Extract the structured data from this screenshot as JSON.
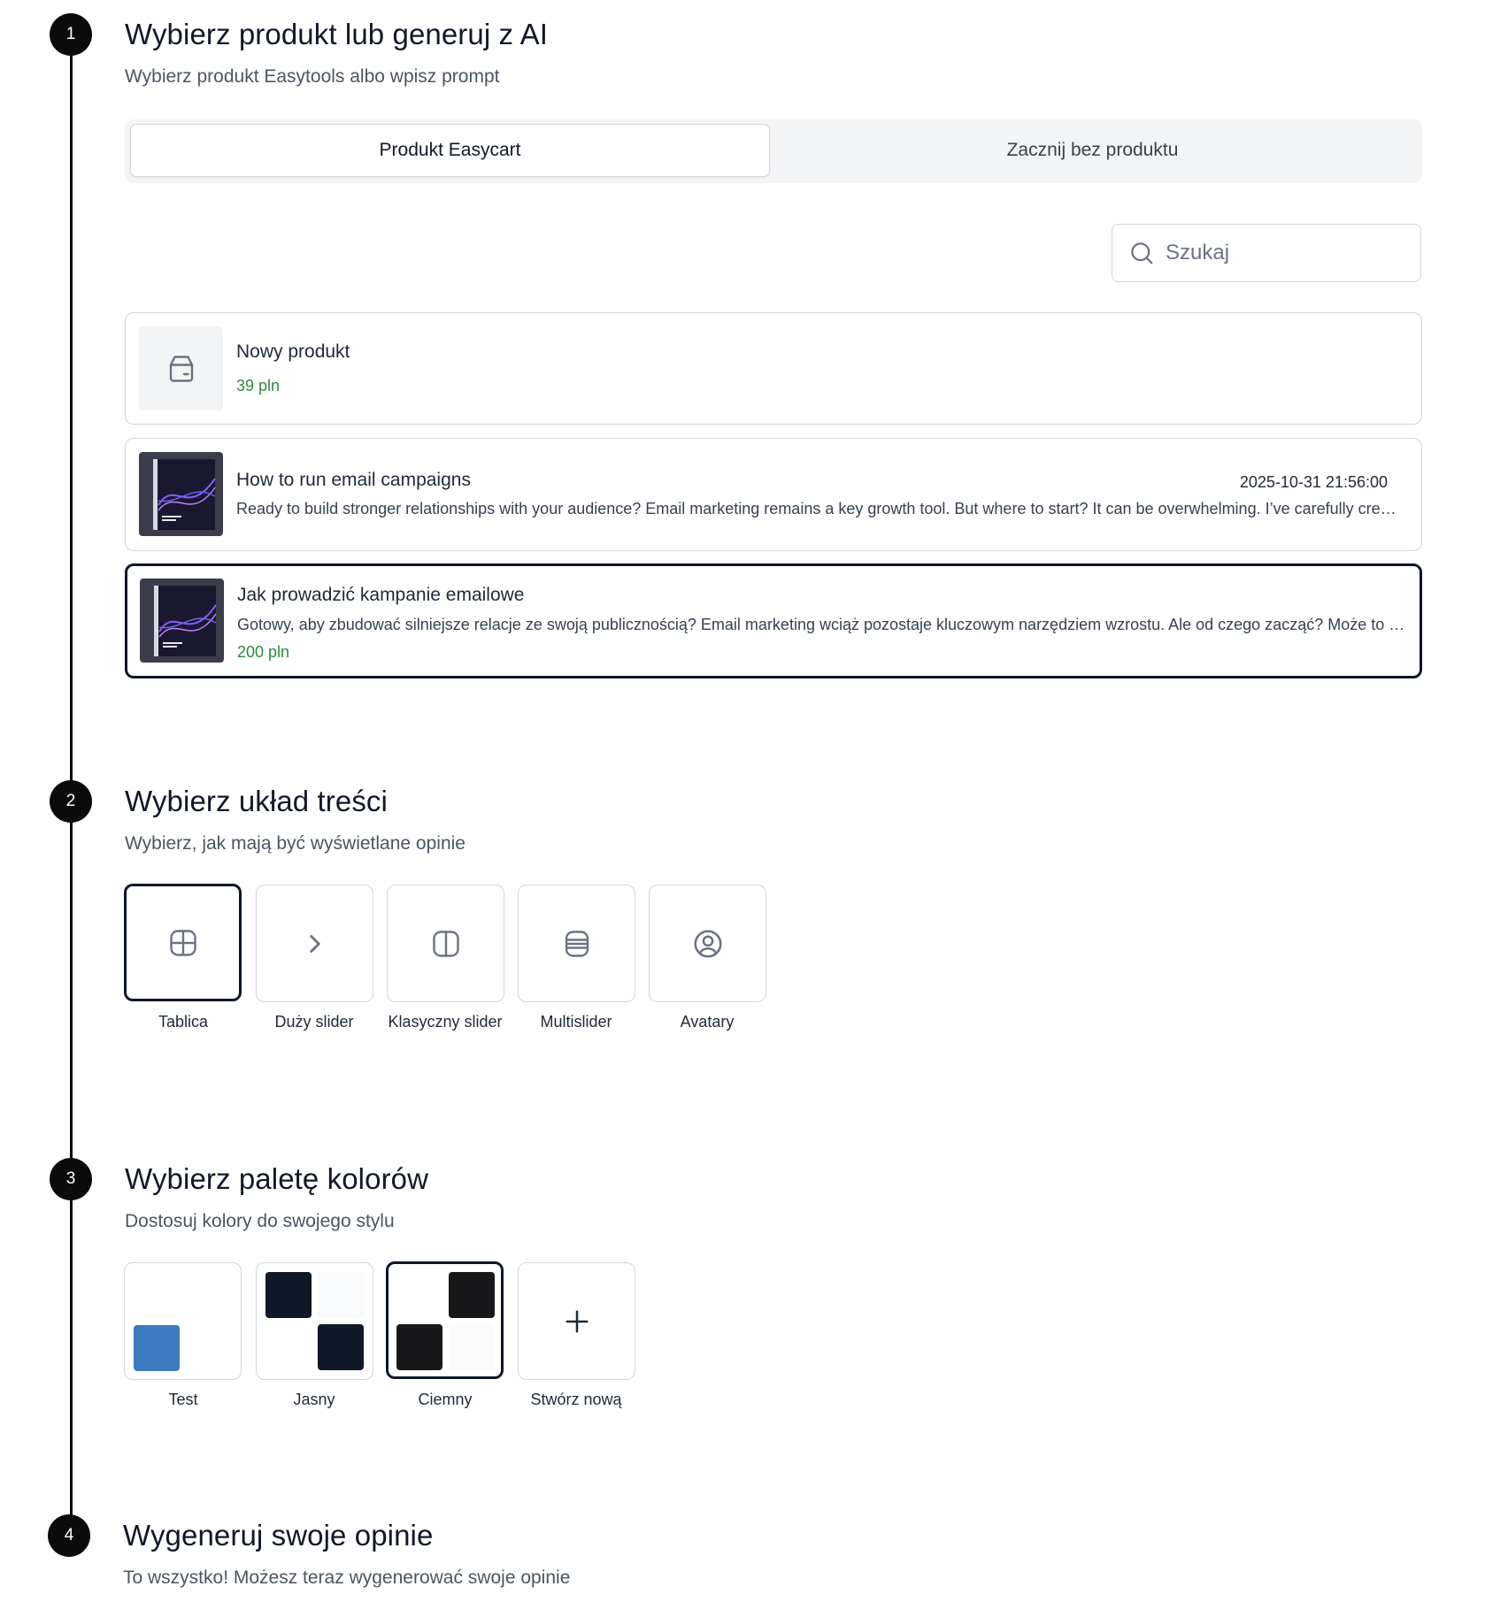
{
  "steps": [
    {
      "number": "1",
      "title": "Wybierz produkt lub generuj z AI",
      "description": "Wybierz produkt Easytools albo wpisz prompt"
    },
    {
      "number": "2",
      "title": "Wybierz układ treści",
      "description": "Wybierz, jak mają być wyświetlane opinie"
    },
    {
      "number": "3",
      "title": "Wybierz paletę kolorów",
      "description": "Dostosuj kolory do swojego stylu"
    },
    {
      "number": "4",
      "title": "Wygeneruj swoje opinie",
      "description": "To wszystko! Możesz teraz wygenerować swoje opinie"
    }
  ],
  "tabs": {
    "active": "Produkt Easycart",
    "inactive": "Zacznij bez produktu"
  },
  "search": {
    "placeholder": "Szukaj"
  },
  "products": [
    {
      "name": "Nowy produkt",
      "price": "39 pln",
      "image": "box-icon"
    },
    {
      "name": "How to run email campaigns",
      "date": "2025-10-31 21:56:00",
      "description": "Ready to build stronger relationships with your audience? Email marketing remains a key growth tool. But where to start? It can be overwhelming. I’ve carefully created this guide to walk you through every step of building successful email campaigns.",
      "image": "book-cover"
    },
    {
      "name": "Jak prowadzić kampanie emailowe",
      "description": "Gotowy, aby zbudować silniejsze relacje ze swoją publicznością? Email marketing wciąż pozostaje kluczowym narzędziem wzrostu. Ale od czego zacząć? Może to być przytłaczające.",
      "price": "200 pln",
      "image": "book-cover",
      "selected": true
    }
  ],
  "layouts": [
    {
      "label": "Tablica",
      "icon": "grid-icon",
      "selected": true
    },
    {
      "label": "Duży slider",
      "icon": "chevron-right-icon"
    },
    {
      "label": "Klasyczny slider",
      "icon": "split-icon"
    },
    {
      "label": "Multislider",
      "icon": "rows-icon"
    },
    {
      "label": "Avatary",
      "icon": "user-circle-icon"
    }
  ],
  "palettes": [
    {
      "label": "Test",
      "colors": [
        "#ffffff",
        "#ffffff",
        "#3b7bbf",
        "#ffffff"
      ]
    },
    {
      "label": "Jasny",
      "colors": [
        "#111827",
        "#f9fafb",
        "#ffffff",
        "#111827"
      ]
    },
    {
      "label": "Ciemny",
      "colors": [
        "#ffffff",
        "#18181b",
        "#18181b",
        "#fafafa"
      ],
      "selected": true
    },
    {
      "label": "Stwórz nową",
      "icon": "plus-icon"
    }
  ]
}
